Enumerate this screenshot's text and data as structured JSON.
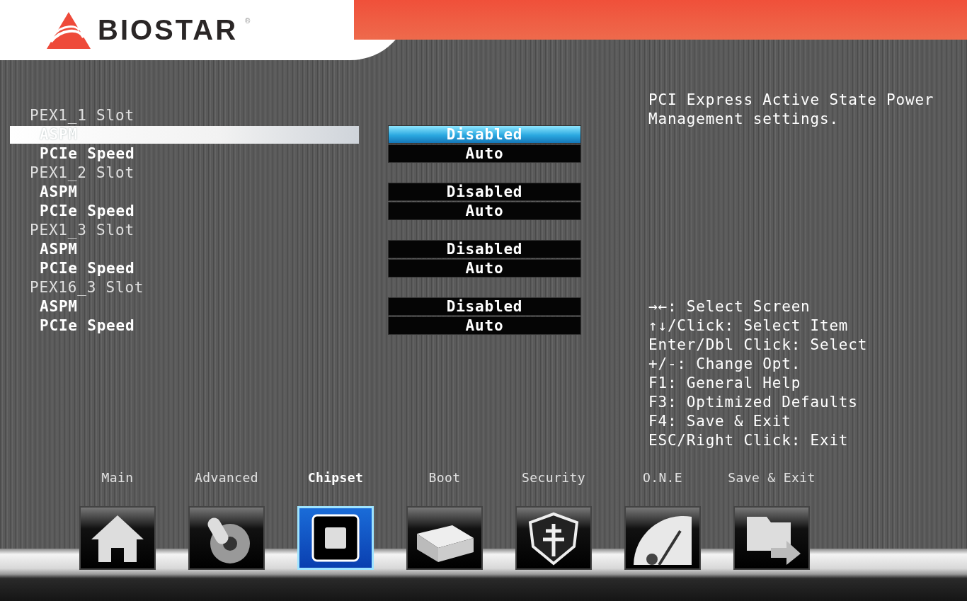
{
  "logo": {
    "text": "BIOSTAR",
    "mark": "®"
  },
  "settings": [
    {
      "label": "PEX1_1 Slot",
      "items": [
        {
          "label": "ASPM",
          "value": "Disabled",
          "selected": true
        },
        {
          "label": "PCIe Speed",
          "value": "Auto",
          "selected": false
        }
      ]
    },
    {
      "label": "PEX1_2 Slot",
      "items": [
        {
          "label": "ASPM",
          "value": "Disabled",
          "selected": false
        },
        {
          "label": "PCIe Speed",
          "value": "Auto",
          "selected": false
        }
      ]
    },
    {
      "label": "PEX1_3 Slot",
      "items": [
        {
          "label": "ASPM",
          "value": "Disabled",
          "selected": false
        },
        {
          "label": "PCIe Speed",
          "value": "Auto",
          "selected": false
        }
      ]
    },
    {
      "label": "PEX16_3 Slot",
      "items": [
        {
          "label": "ASPM",
          "value": "Disabled",
          "selected": false
        },
        {
          "label": "PCIe Speed",
          "value": "Auto",
          "selected": false
        }
      ]
    }
  ],
  "help_text": "PCI Express Active State Power Management settings.",
  "key_help": [
    "→←: Select Screen",
    "↑↓/Click: Select Item",
    "Enter/Dbl Click: Select",
    "+/-: Change Opt.",
    "F1: General Help",
    "F3: Optimized Defaults",
    "F4: Save & Exit",
    "ESC/Right Click: Exit"
  ],
  "tabs": [
    {
      "label": "Main",
      "selected": false
    },
    {
      "label": "Advanced",
      "selected": false
    },
    {
      "label": "Chipset",
      "selected": true
    },
    {
      "label": "Boot",
      "selected": false
    },
    {
      "label": "Security",
      "selected": false
    },
    {
      "label": "O.N.E",
      "selected": false
    },
    {
      "label": "Save & Exit",
      "selected": false
    }
  ]
}
